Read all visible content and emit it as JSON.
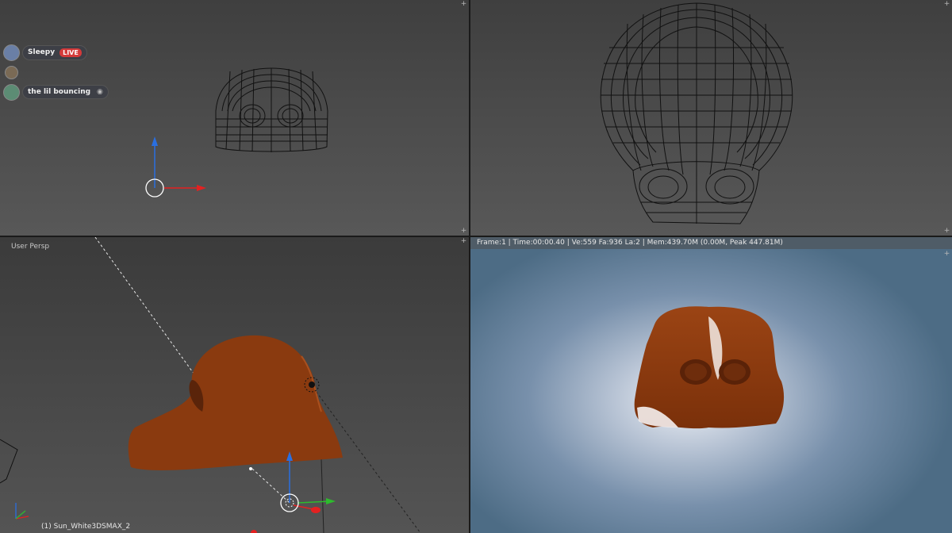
{
  "viewports": {
    "top_left": {
      "label": "",
      "overlay_users": [
        {
          "name": "Sleepy",
          "badge": "LIVE",
          "avatar_color": "#6a7fa6"
        },
        {
          "name": "",
          "badge": "",
          "avatar_color": "#7a6a55"
        },
        {
          "name": "the lil bouncing",
          "badge": "",
          "avatar_color": "#5c8c74",
          "icon": "eye-icon"
        }
      ]
    },
    "top_right": {
      "label": ""
    },
    "bottom_left": {
      "label": "User Persp",
      "footer": "(1) Sun_White3DSMAX_2"
    },
    "bottom_right": {
      "info": "Frame:1 | Time:00:00.40 | Ve:559 Fa:936 La:2 | Mem:439.70M (0.00M, Peak 447.81M)"
    }
  },
  "icons": {
    "corner_widget": "plus-icon"
  },
  "colors": {
    "model": "#8a3a0f",
    "axis_x": "#e32121",
    "axis_y": "#2dbb2d",
    "axis_z": "#2a6fe0",
    "render_bg": "#5f7d96",
    "wire": "#111111"
  }
}
